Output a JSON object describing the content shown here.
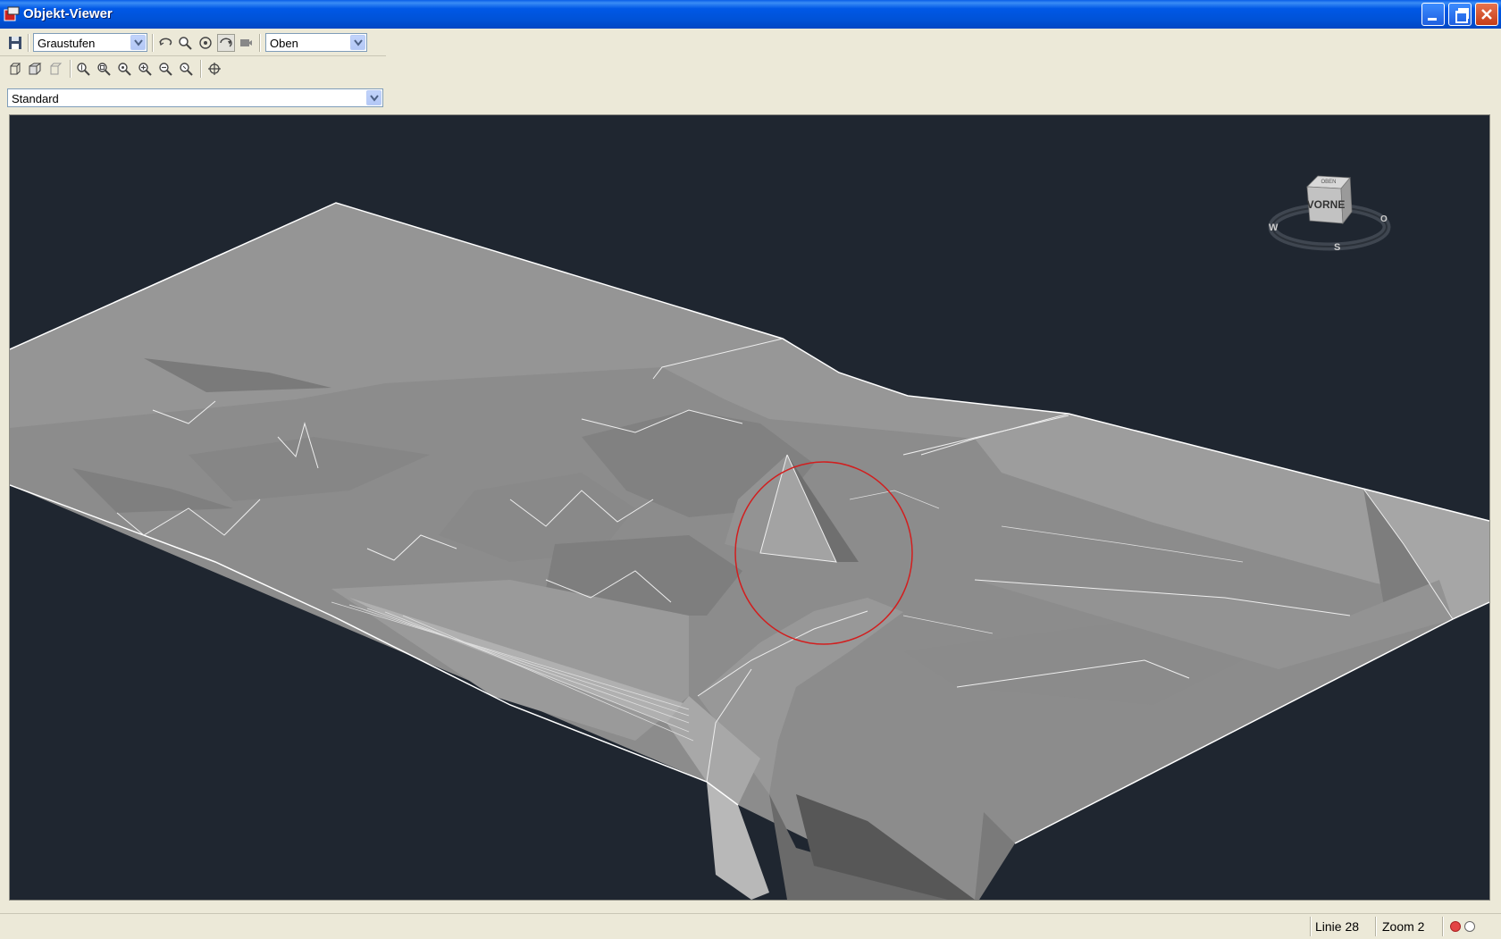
{
  "window": {
    "title": "Objekt-Viewer"
  },
  "toolbar": {
    "visual_style": {
      "selected": "Graustufen"
    },
    "view": {
      "selected": "Oben"
    },
    "ucs": {
      "selected": "Standard"
    }
  },
  "viewcube": {
    "face_top": "OBEN",
    "face_front": "VORNE",
    "compass_w": "W",
    "compass_o": "O",
    "compass_s": "S"
  },
  "colors": {
    "viewport_background": "#1F2630",
    "terrain": "#8E8E8E",
    "selection_circle": "#D21E1E"
  },
  "statusbar": {
    "line": "Linie 28",
    "zoom": "Zoom 2"
  }
}
